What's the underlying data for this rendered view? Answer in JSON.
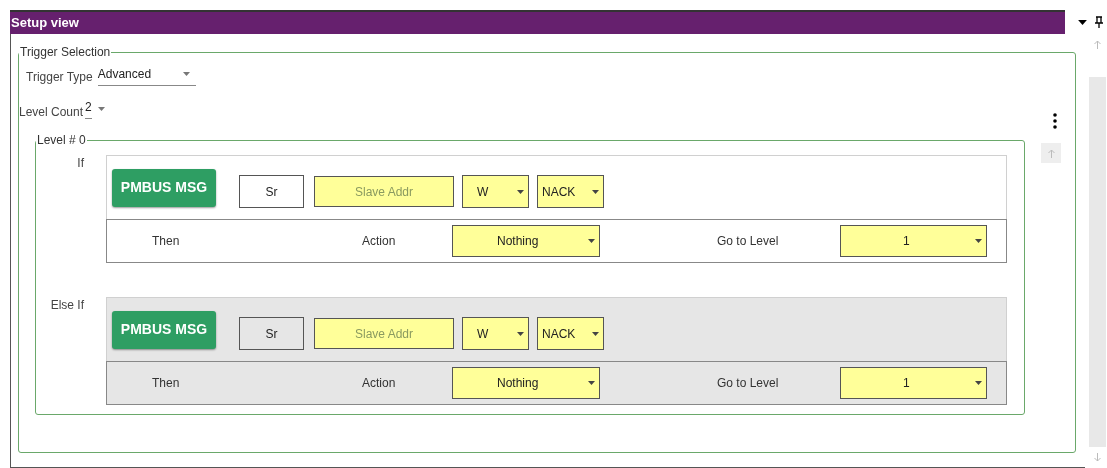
{
  "window": {
    "title": "Setup view"
  },
  "trigger_selection": {
    "legend": "Trigger Selection",
    "trigger_type": {
      "label": "Trigger Type",
      "value": "Advanced"
    },
    "level_count": {
      "label": "Level Count",
      "value": "2"
    }
  },
  "level": {
    "legend": "Level # 0",
    "conditions": [
      {
        "label": "If",
        "selected": false,
        "message_button": "PMBUS MSG",
        "start": "Sr",
        "address_placeholder": "Slave Addr",
        "rw": "W",
        "ack": "NACK",
        "then_label": "Then",
        "action_label": "Action",
        "action": "Nothing",
        "goto_label": "Go to Level",
        "goto": "1"
      },
      {
        "label": "Else If",
        "selected": true,
        "message_button": "PMBUS MSG",
        "start": "Sr",
        "address_placeholder": "Slave Addr",
        "rw": "W",
        "ack": "NACK",
        "then_label": "Then",
        "action_label": "Action",
        "action": "Nothing",
        "goto_label": "Go to Level",
        "goto": "1"
      }
    ]
  }
}
